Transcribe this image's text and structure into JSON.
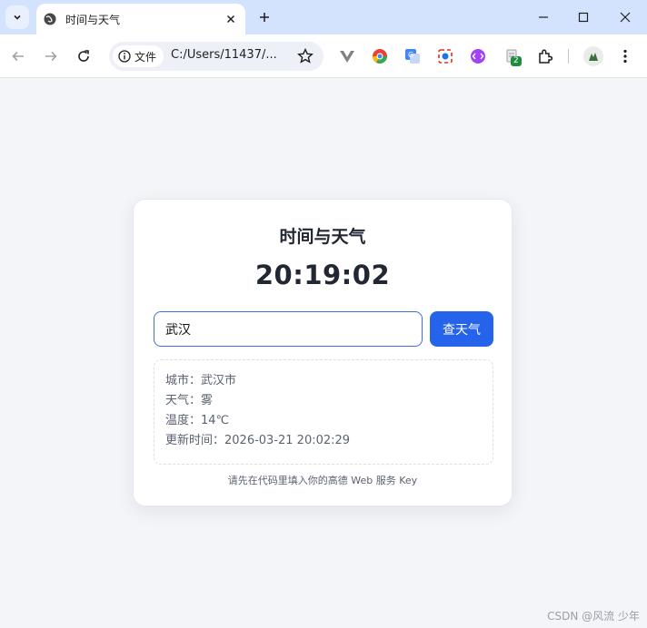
{
  "browser": {
    "tab_title": "时间与天气",
    "chip_label": "文件",
    "url": "C:/Users/11437/...",
    "extension_badge": "2"
  },
  "app": {
    "title": "时间与天气",
    "time": "20:19:02",
    "city_value": "武汉",
    "button_label": "查天气",
    "city_line": "城市：武汉市",
    "weather_line": "天气：雾",
    "temperature_line": "温度：14℃",
    "updated_line": "更新时间：2026-03-21 20:02:29",
    "note": "请先在代码里填入你的高德 Web 服务 Key"
  },
  "watermark": "CSDN @风流 少年",
  "colors": {
    "accent": "#2563eb",
    "titlebar": "#d3e3fd",
    "page_bg": "#f3f5f9"
  }
}
